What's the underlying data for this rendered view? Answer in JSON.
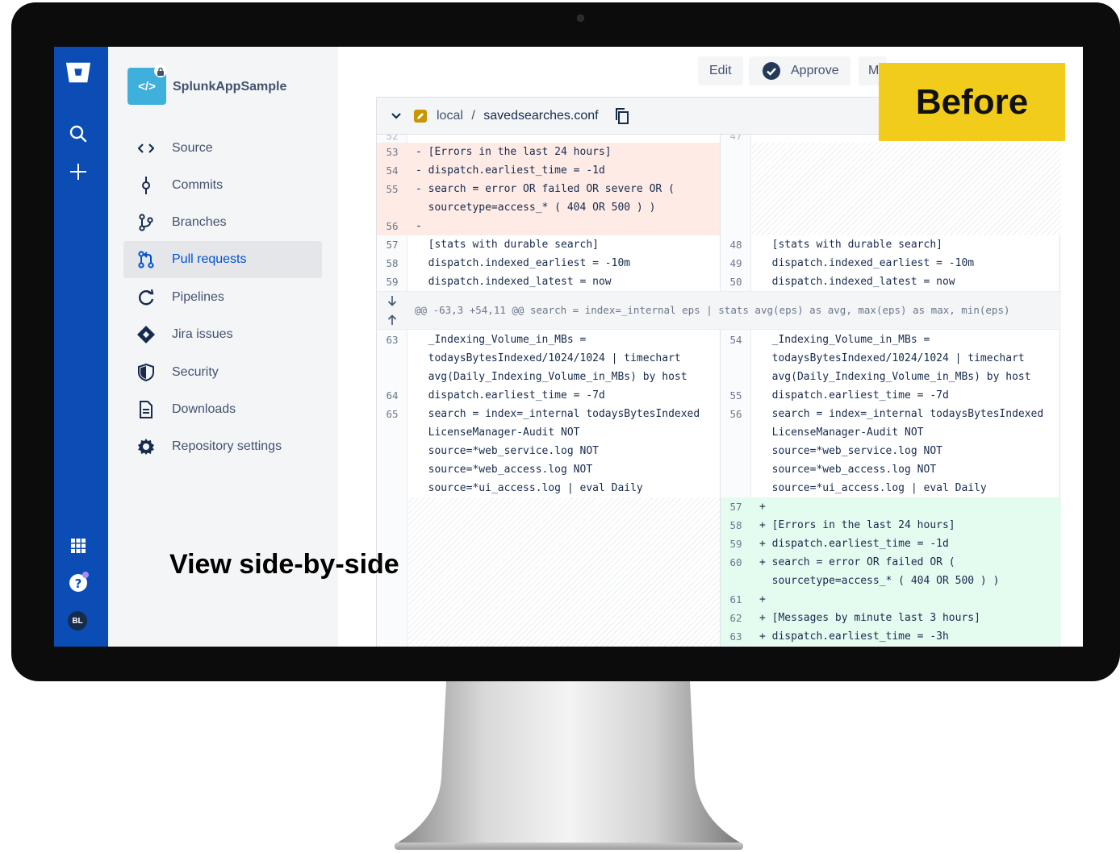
{
  "app": {
    "repo_name": "SplunkAppSample"
  },
  "sidebar": {
    "items": [
      {
        "label": "Source",
        "icon": "code-icon"
      },
      {
        "label": "Commits",
        "icon": "commit-icon"
      },
      {
        "label": "Branches",
        "icon": "branch-icon"
      },
      {
        "label": "Pull requests",
        "icon": "pull-request-icon",
        "active": true
      },
      {
        "label": "Pipelines",
        "icon": "pipelines-icon"
      },
      {
        "label": "Jira issues",
        "icon": "jira-icon"
      },
      {
        "label": "Security",
        "icon": "shield-icon"
      },
      {
        "label": "Downloads",
        "icon": "file-icon"
      },
      {
        "label": "Repository settings",
        "icon": "gear-icon"
      }
    ]
  },
  "toolbar": {
    "edit_label": "Edit",
    "approve_label": "Approve",
    "more_label": "M"
  },
  "file": {
    "path_dir": "local",
    "separator": "/",
    "filename": "savedsearches.conf"
  },
  "diff": {
    "left_rows": [
      {
        "ln": "53",
        "code": "- [Errors in the last 24 hours]"
      },
      {
        "ln": "54",
        "code": "- dispatch.earliest_time = -1d"
      },
      {
        "ln": "55",
        "code": "- search = error OR failed OR severe OR ("
      },
      {
        "ln": "",
        "code": "  sourcetype=access_* ( 404 OR 500 ) )"
      },
      {
        "ln": "56",
        "code": "-"
      },
      {
        "ln": "57",
        "code": "  [stats with durable search]"
      },
      {
        "ln": "58",
        "code": "  dispatch.indexed_earliest = -10m"
      },
      {
        "ln": "59",
        "code": "  dispatch.indexed_latest = now"
      },
      {
        "ln": "63",
        "code": "  _Indexing_Volume_in_MBs ="
      },
      {
        "ln": "",
        "code": "  todaysBytesIndexed/1024/1024 | timechart"
      },
      {
        "ln": "",
        "code": "  avg(Daily_Indexing_Volume_in_MBs) by host"
      },
      {
        "ln": "64",
        "code": "  dispatch.earliest_time = -7d"
      },
      {
        "ln": "65",
        "code": "  search = index=_internal todaysBytesIndexed"
      },
      {
        "ln": "",
        "code": "  LicenseManager-Audit NOT"
      },
      {
        "ln": "",
        "code": "  source=*web_service.log NOT"
      },
      {
        "ln": "",
        "code": "  source=*web_access.log NOT"
      },
      {
        "ln": "",
        "code": "  source=*ui_access.log | eval Daily"
      }
    ],
    "right_rows": [
      {
        "ln": "48",
        "code": "  [stats with durable search]"
      },
      {
        "ln": "49",
        "code": "  dispatch.indexed_earliest = -10m"
      },
      {
        "ln": "50",
        "code": "  dispatch.indexed_latest = now"
      },
      {
        "ln": "54",
        "code": "  _Indexing_Volume_in_MBs ="
      },
      {
        "ln": "",
        "code": "  todaysBytesIndexed/1024/1024 | timechart"
      },
      {
        "ln": "",
        "code": "  avg(Daily_Indexing_Volume_in_MBs) by host"
      },
      {
        "ln": "55",
        "code": "  dispatch.earliest_time = -7d"
      },
      {
        "ln": "56",
        "code": "  search = index=_internal todaysBytesIndexed"
      },
      {
        "ln": "",
        "code": "  LicenseManager-Audit NOT"
      },
      {
        "ln": "",
        "code": "  source=*web_service.log NOT"
      },
      {
        "ln": "",
        "code": "  source=*web_access.log NOT"
      },
      {
        "ln": "",
        "code": "  source=*ui_access.log | eval Daily"
      },
      {
        "ln": "57",
        "code": "+"
      },
      {
        "ln": "58",
        "code": "+ [Errors in the last 24 hours]"
      },
      {
        "ln": "59",
        "code": "+ dispatch.earliest_time = -1d"
      },
      {
        "ln": "60",
        "code": "+ search = error OR failed OR ("
      },
      {
        "ln": "",
        "code": "  sourcetype=access_* ( 404 OR 500 ) )"
      },
      {
        "ln": "61",
        "code": "+"
      },
      {
        "ln": "62",
        "code": "+ [Messages by minute last 3 hours]"
      },
      {
        "ln": "63",
        "code": "+ dispatch.earliest_time = -3h"
      }
    ],
    "hunk_header": "@@ -63,3 +54,11 @@ search = index=_internal eps | stats avg(eps) as avg, max(eps) as max, min(eps)"
  },
  "overlay": {
    "badge": "Before",
    "caption": "View side-by-side"
  },
  "user": {
    "initials": "BL"
  },
  "colors": {
    "nav_blue": "#0b4db5",
    "deleted_bg": "#ffebe6",
    "added_bg": "#e3fcef",
    "badge_yellow": "#f1cc1b",
    "active_link": "#0052cc"
  }
}
